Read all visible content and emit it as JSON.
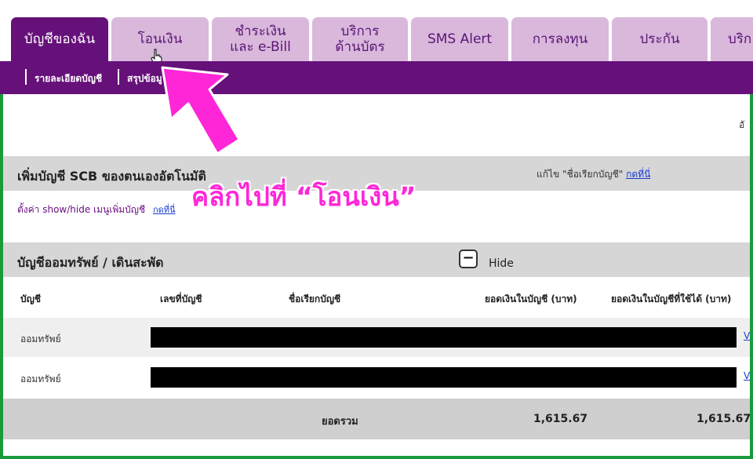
{
  "tabs": [
    {
      "label": "บัญชีของฉัน",
      "active": true
    },
    {
      "label": "โอนเงิน",
      "active": false
    },
    {
      "label": "ชำระเงิน\nและ e-Bill",
      "active": false
    },
    {
      "label": "บริการ\nด้านบัตร",
      "active": false
    },
    {
      "label": "SMS Alert",
      "active": false
    },
    {
      "label": "การลงทุน",
      "active": false
    },
    {
      "label": "ประกัน",
      "active": false
    },
    {
      "label": "บริก",
      "active": false
    }
  ],
  "subnav": {
    "item1": "รายละเอียดบัญชี",
    "item2": "สรุปข้อมู"
  },
  "top_right_text": "อั",
  "add_account": {
    "title": "เพิ่มบัญชี SCB ของตนเองอัตโนมัติ",
    "edit_label": "แก้ไข \"ชื่อเรียกบัญชี\"",
    "edit_link": "กดที่นี่"
  },
  "setting": {
    "text": "ตั้งค่า show/hide เมนูเพิ่มบัญชี",
    "link": "กดที่นี่"
  },
  "savings": {
    "title": "บัญชีออมทรัพย์ / เดินสะพัด",
    "hide_symbol": "−",
    "hide_label": "Hide",
    "columns": [
      "บัญชี",
      "เลขที่บัญชี",
      "ชื่อเรียกบัญชี",
      "ยอดเงินในบัญชี (บาท)",
      "ยอดเงินในบัญชีที่ใช้ได้ (บาท)"
    ],
    "rows": [
      {
        "type": "ออมทรัพย์",
        "link": "V"
      },
      {
        "type": "ออมทรัพย์",
        "link": "V"
      }
    ],
    "total_label": "ยอดรวม",
    "total_balance": "1,615.67",
    "total_available": "1,615.67"
  },
  "annotation": {
    "text": "คลิกไปที่ “โอนเงิน”",
    "color": "#ff26d8"
  },
  "colors": {
    "brand_purple": "#66107a",
    "tab_inactive": "#d9b8dc",
    "frame_green": "#1a9a3a"
  }
}
